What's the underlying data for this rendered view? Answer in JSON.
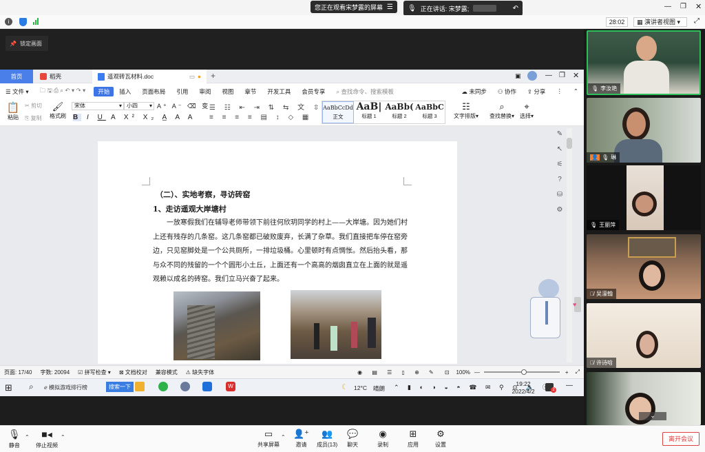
{
  "top": {
    "viewing_text": "您正在观看宋梦露的屏幕",
    "speaking_text": "正在讲话: 宋梦露;",
    "timer": "28:02",
    "presenter_view": "演讲者视图"
  },
  "lock_screen": "锁定画面",
  "wps": {
    "tabs": {
      "home": "首页",
      "docer": "稻壳",
      "doc": "遥观砖瓦材料.doc"
    },
    "menu": {
      "file": "文件",
      "items": [
        "开始",
        "插入",
        "页面布局",
        "引用",
        "审阅",
        "视图",
        "章节",
        "开发工具",
        "会员专享"
      ],
      "search_placeholder": "查找命令、搜索模板",
      "sync": "未同步",
      "collab": "协作",
      "share": "分享"
    },
    "ribbon": {
      "paste": "粘贴",
      "cut": "剪切",
      "copy": "复制",
      "format_painter": "格式刷",
      "font": "宋体",
      "size": "小四",
      "styles": [
        {
          "preview": "AaBbCcDd",
          "name": "正文"
        },
        {
          "preview": "AaB|",
          "name": "标题 1"
        },
        {
          "preview": "AaBb(",
          "name": "标题 2"
        },
        {
          "preview": "AaBbC",
          "name": "标题 3"
        }
      ],
      "text_layout": "文字排版",
      "find_replace": "查找替换",
      "select": "选择"
    },
    "document": {
      "heading": "（二）、实地考察，寻访砖窑",
      "subheading": "1、走访遥观大岸塘村",
      "body": "一放寒假我们在辅导老师带领下前往何欣玥同学的村上——大岸塘。因为她们村上还有残存的几条窑。这几条窑都已破败废弃，长满了杂草。我们直接把车停在窑旁边，只见窑脚处是一个公共厕所，一排垃圾桶。心里顿时有点惆怅。然后抬头看，那与众不同的残留的一个个圆形小土丘，上面还有一个高高的烟囱直立在上面的就是遥观赖以成名的砖窑。我们立马兴奋了起来。"
    },
    "status": {
      "page": "页面: 17/40",
      "words": "字数: 20094",
      "spell": "拼写检查",
      "proof": "文档校对",
      "compat": "兼容模式",
      "missing_font": "缺失字体",
      "zoom": "100%"
    }
  },
  "taskbar": {
    "app_label": "模拟游戏排行榜",
    "search_btn": "搜索一下",
    "weather_temp": "12°C",
    "weather_desc": "晴朗",
    "time": "19:22",
    "date": "2022/4/2",
    "badge": "2"
  },
  "participants": [
    {
      "name": "李汝艳"
    },
    {
      "name": "琳"
    },
    {
      "name": "王丽萍"
    },
    {
      "name": "吴濛翰"
    },
    {
      "name": "许诗晗"
    },
    {
      "name": ""
    }
  ],
  "bottom": {
    "mute": "静音",
    "stop_video": "停止视频",
    "share_screen": "共享屏幕",
    "invite": "邀请",
    "members": "成员(13)",
    "chat": "聊天",
    "record": "录制",
    "apps": "应用",
    "settings": "设置",
    "leave": "离开会议"
  }
}
